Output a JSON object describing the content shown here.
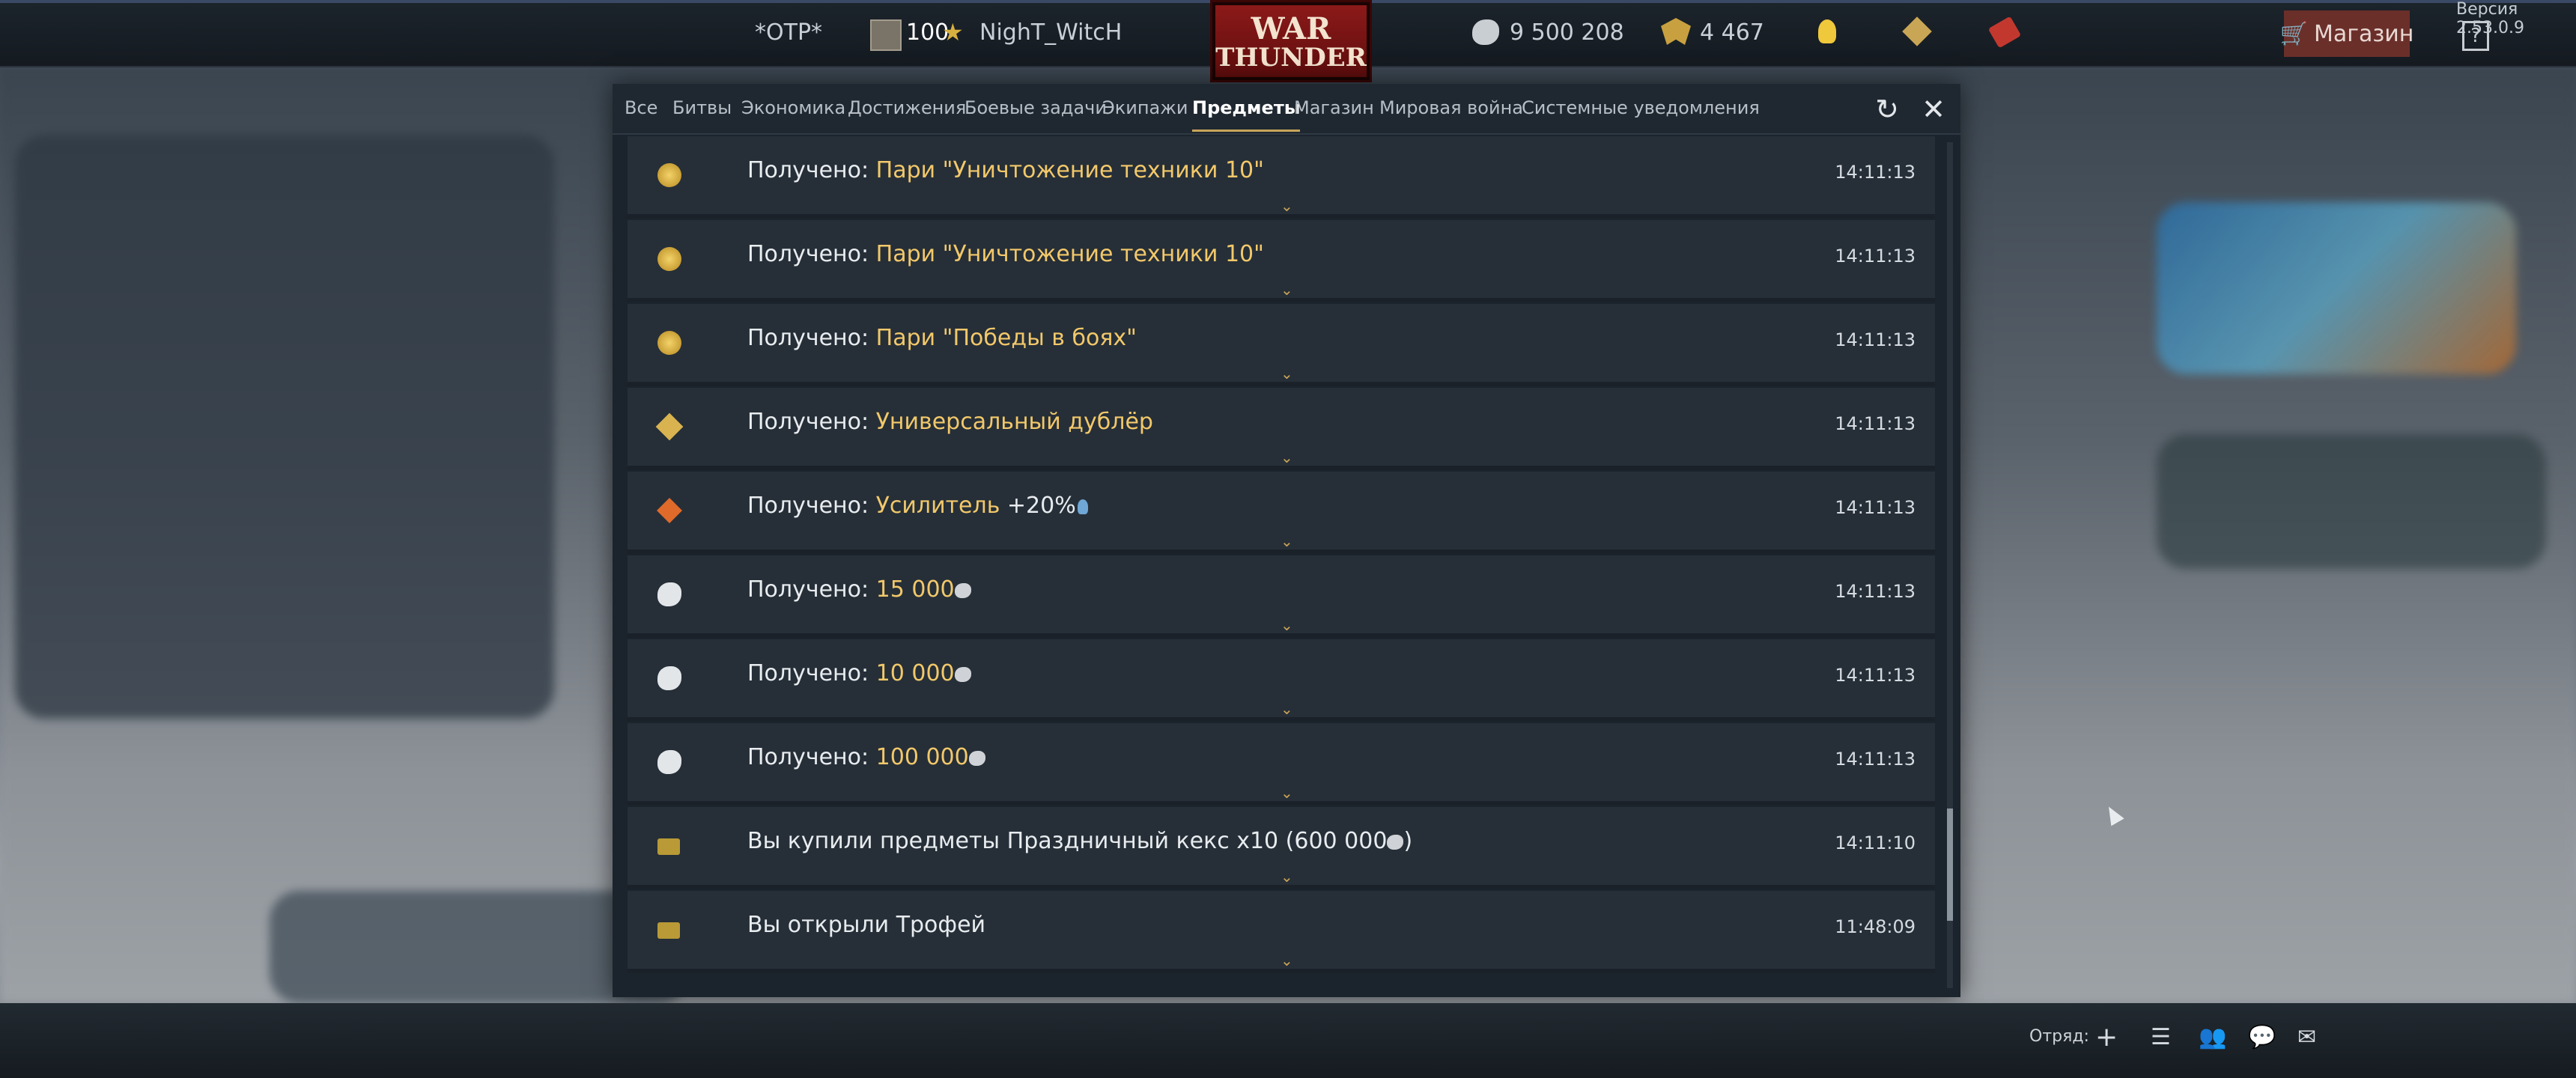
{
  "header": {
    "version": "Версия 2.53.0.9",
    "squad_tag": "*OTP*",
    "player_level": "100",
    "player_name": "NighT_WitcH",
    "logo_line1": "WAR",
    "logo_line2": "THUNDER",
    "silver_lions": "9 500 208",
    "golden_eagles": "4 467",
    "shop_label": "Магазин",
    "help_label": "?"
  },
  "tabs": [
    {
      "label": "Все"
    },
    {
      "label": "Битвы"
    },
    {
      "label": "Экономика"
    },
    {
      "label": "Достижения"
    },
    {
      "label": "Боевые задачи"
    },
    {
      "label": "Экипажи"
    },
    {
      "label": "Предметы",
      "active": true
    },
    {
      "label": "Магазин"
    },
    {
      "label": "Мировая война"
    },
    {
      "label": "Системные уведомления"
    }
  ],
  "rows": [
    {
      "prefix": "Получено: ",
      "item": "Пари \"Уничтожение техники 10\"",
      "suffix": "",
      "time": "14:11:13",
      "icon": "gold-medal-icon"
    },
    {
      "prefix": "Получено: ",
      "item": "Пари \"Уничтожение техники 10\"",
      "suffix": "",
      "time": "14:11:13",
      "icon": "gold-medal-icon"
    },
    {
      "prefix": "Получено: ",
      "item": "Пари \"Победы в боях\"",
      "suffix": "",
      "time": "14:11:13",
      "icon": "gold-medal-icon"
    },
    {
      "prefix": "Получено: ",
      "item": "Универсальный дублёр",
      "suffix": "",
      "time": "14:11:13",
      "icon": "backup-ticket-icon"
    },
    {
      "prefix": "Получено: ",
      "item": "Усилитель",
      "suffix": " +20%",
      "time": "14:11:13",
      "icon": "booster-icon"
    },
    {
      "prefix": "Получено: ",
      "item": "15 000",
      "suffix": "",
      "time": "14:11:13",
      "icon": "silver-lion-icon"
    },
    {
      "prefix": "Получено: ",
      "item": "10 000",
      "suffix": "",
      "time": "14:11:13",
      "icon": "silver-lion-icon"
    },
    {
      "prefix": "Получено: ",
      "item": "100 000",
      "suffix": "",
      "time": "14:11:13",
      "icon": "silver-lion-icon"
    },
    {
      "prefix": "Вы купили предметы Праздничный кекс x10 (600 000",
      "item": "",
      "suffix": ")",
      "time": "14:11:10",
      "icon": "trophy-chest-icon"
    },
    {
      "prefix": "Вы открыли Трофей",
      "item": "",
      "suffix": "",
      "time": "11:48:09",
      "icon": "trophy-chest-icon"
    }
  ],
  "bottom": {
    "squad_label": "Отряд:"
  },
  "colors": {
    "highlight": "#f2c86a",
    "tab_accent": "#c8a55a",
    "shop": "#6b2f2a"
  }
}
